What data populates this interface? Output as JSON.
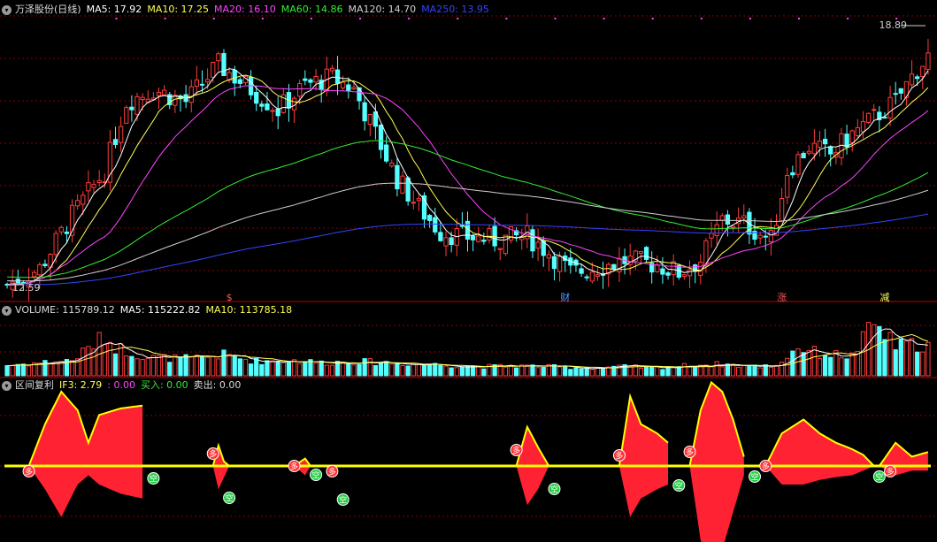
{
  "colors": {
    "up": "#ff3b3b",
    "down": "#54ffff",
    "ma5": "#ffffff",
    "ma10": "#ffff55",
    "ma20": "#ff44ff",
    "ma60": "#33ee33",
    "ma120": "#cfcfcf",
    "ma250": "#3344ff",
    "grid": "#8a0000",
    "signal": "#ffff00",
    "area": "#ff2233",
    "buy": "#ff3333",
    "sell": "#22cc44"
  },
  "main_legend": {
    "control_icon": "chevron-down-icon",
    "title": "万泽股份(日线)",
    "ma5": "MA5: 17.92",
    "ma10": "MA10: 17.25",
    "ma20": "MA20: 16.10",
    "ma60": "MA60: 14.86",
    "ma120": "MA120: 14.70",
    "ma250": "MA250: 13.95"
  },
  "price_high": "18.89",
  "price_low": "12.59",
  "event_markers": [
    {
      "text": "$",
      "x_index": 41
    },
    {
      "text": "财",
      "x_index": 103
    },
    {
      "text": "涨",
      "x_index": 143
    },
    {
      "text": "减",
      "x_index": 162
    }
  ],
  "volume_legend": {
    "title": "VOLUME: 115789.12",
    "ma5": "MA5: 115222.82",
    "ma10": "MA10: 113785.18"
  },
  "indicator_legend": {
    "title": "区间复利",
    "if3": "IF3: 2.79",
    "v0": ": 0.00",
    "buy": "买入: 0.00",
    "sell": "卖出: 0.00"
  },
  "signal_labels": {
    "buy": "多",
    "sell": "空"
  },
  "chart_data": {
    "type": "candlestick",
    "title": "万泽股份(日线)",
    "n_bars": 171,
    "ylim": [
      12.4,
      19.3
    ],
    "price_anchors": [
      [
        0,
        12.7
      ],
      [
        6,
        13.1
      ],
      [
        12,
        14.4
      ],
      [
        18,
        15.5
      ],
      [
        22,
        17.2
      ],
      [
        27,
        17.5
      ],
      [
        33,
        17.2
      ],
      [
        39,
        18.1
      ],
      [
        44,
        17.6
      ],
      [
        50,
        17.0
      ],
      [
        55,
        17.6
      ],
      [
        60,
        17.8
      ],
      [
        64,
        17.5
      ],
      [
        68,
        16.4
      ],
      [
        72,
        15.3
      ],
      [
        76,
        14.6
      ],
      [
        80,
        14.0
      ],
      [
        84,
        13.9
      ],
      [
        90,
        13.8
      ],
      [
        96,
        13.9
      ],
      [
        100,
        13.5
      ],
      [
        104,
        13.0
      ],
      [
        108,
        13.1
      ],
      [
        114,
        13.3
      ],
      [
        120,
        13.2
      ],
      [
        124,
        13.0
      ],
      [
        128,
        13.3
      ],
      [
        132,
        14.3
      ],
      [
        136,
        14.2
      ],
      [
        141,
        13.8
      ],
      [
        144,
        15.5
      ],
      [
        148,
        16.1
      ],
      [
        152,
        15.9
      ],
      [
        156,
        16.4
      ],
      [
        160,
        16.8
      ],
      [
        164,
        17.2
      ],
      [
        168,
        18.0
      ],
      [
        170,
        18.3
      ]
    ],
    "volume_ylim": [
      0,
      220000
    ],
    "volume_anchors": [
      [
        0,
        40000
      ],
      [
        6,
        50000
      ],
      [
        12,
        60000
      ],
      [
        18,
        150000
      ],
      [
        20,
        110000
      ],
      [
        26,
        70000
      ],
      [
        34,
        65000
      ],
      [
        40,
        80000
      ],
      [
        46,
        55000
      ],
      [
        52,
        60000
      ],
      [
        58,
        50000
      ],
      [
        64,
        55000
      ],
      [
        70,
        50000
      ],
      [
        76,
        45000
      ],
      [
        82,
        40000
      ],
      [
        88,
        35000
      ],
      [
        94,
        38000
      ],
      [
        100,
        35000
      ],
      [
        106,
        30000
      ],
      [
        114,
        35000
      ],
      [
        120,
        30000
      ],
      [
        126,
        40000
      ],
      [
        132,
        45000
      ],
      [
        138,
        35000
      ],
      [
        142,
        40000
      ],
      [
        146,
        110000
      ],
      [
        150,
        85000
      ],
      [
        156,
        75000
      ],
      [
        160,
        200000
      ],
      [
        164,
        115000
      ],
      [
        168,
        120000
      ],
      [
        170,
        115000
      ]
    ],
    "indicator": {
      "name": "区间复利",
      "baseline": 0,
      "segments": [
        {
          "from": 4,
          "to": 25,
          "top": [
            [
              4,
              0
            ],
            [
              7,
              0.45
            ],
            [
              10,
              0.8
            ],
            [
              13,
              0.6
            ],
            [
              15,
              0.25
            ],
            [
              17,
              0.55
            ],
            [
              21,
              0.62
            ],
            [
              25,
              0.65
            ]
          ],
          "bottom": [
            [
              4,
              0
            ],
            [
              7,
              -0.25
            ],
            [
              10,
              -0.55
            ],
            [
              13,
              -0.2
            ],
            [
              15,
              -0.1
            ],
            [
              17,
              -0.2
            ],
            [
              21,
              -0.3
            ],
            [
              25,
              -0.35
            ]
          ]
        },
        {
          "from": 38,
          "to": 41,
          "top": [
            [
              38,
              0
            ],
            [
              39,
              0.22
            ],
            [
              40,
              0.05
            ],
            [
              41,
              0
            ]
          ],
          "bottom": [
            [
              38,
              0
            ],
            [
              39,
              -0.25
            ],
            [
              41,
              0
            ]
          ]
        },
        {
          "from": 53,
          "to": 56,
          "top": [
            [
              53,
              0
            ],
            [
              55,
              0.08
            ],
            [
              56,
              0
            ]
          ],
          "bottom": [
            [
              53,
              0
            ],
            [
              55,
              -0.1
            ],
            [
              56,
              0
            ]
          ]
        },
        {
          "from": 94,
          "to": 100,
          "top": [
            [
              94,
              0
            ],
            [
              96,
              0.42
            ],
            [
              98,
              0.2
            ],
            [
              100,
              0
            ]
          ],
          "bottom": [
            [
              94,
              0
            ],
            [
              96,
              -0.42
            ],
            [
              98,
              -0.25
            ],
            [
              100,
              0
            ]
          ]
        },
        {
          "from": 113,
          "to": 122,
          "top": [
            [
              113,
              0
            ],
            [
              115,
              0.75
            ],
            [
              117,
              0.45
            ],
            [
              120,
              0.35
            ],
            [
              122,
              0.25
            ]
          ],
          "bottom": [
            [
              113,
              0
            ],
            [
              115,
              -0.55
            ],
            [
              117,
              -0.35
            ],
            [
              120,
              -0.25
            ],
            [
              122,
              -0.2
            ]
          ]
        },
        {
          "from": 126,
          "to": 136,
          "top": [
            [
              126,
              0
            ],
            [
              128,
              0.6
            ],
            [
              130,
              0.9
            ],
            [
              132,
              0.8
            ],
            [
              134,
              0.5
            ],
            [
              136,
              0.1
            ]
          ],
          "bottom": [
            [
              126,
              0
            ],
            [
              128,
              -0.8
            ],
            [
              130,
              -1.05
            ],
            [
              132,
              -0.9
            ],
            [
              134,
              -0.5
            ],
            [
              136,
              -0.1
            ]
          ]
        },
        {
          "from": 140,
          "to": 160,
          "top": [
            [
              140,
              0
            ],
            [
              143,
              0.35
            ],
            [
              147,
              0.5
            ],
            [
              150,
              0.35
            ],
            [
              153,
              0.25
            ],
            [
              156,
              0.18
            ],
            [
              158,
              0.12
            ],
            [
              160,
              0
            ]
          ],
          "bottom": [
            [
              140,
              0
            ],
            [
              143,
              -0.2
            ],
            [
              147,
              -0.2
            ],
            [
              150,
              -0.15
            ],
            [
              153,
              -0.12
            ],
            [
              156,
              -0.1
            ],
            [
              158,
              -0.05
            ],
            [
              160,
              0
            ]
          ]
        },
        {
          "from": 161,
          "to": 170,
          "top": [
            [
              161,
              0
            ],
            [
              164,
              0.25
            ],
            [
              167,
              0.1
            ],
            [
              170,
              0.15
            ]
          ],
          "bottom": [
            [
              161,
              0
            ],
            [
              164,
              -0.1
            ],
            [
              167,
              -0.05
            ],
            [
              170,
              -0.05
            ]
          ]
        }
      ],
      "buy_signals": [
        4,
        38,
        53,
        60,
        94,
        113,
        126,
        140,
        163
      ],
      "sell_signals": [
        27,
        41,
        57,
        62,
        101,
        124,
        138,
        161
      ]
    }
  }
}
